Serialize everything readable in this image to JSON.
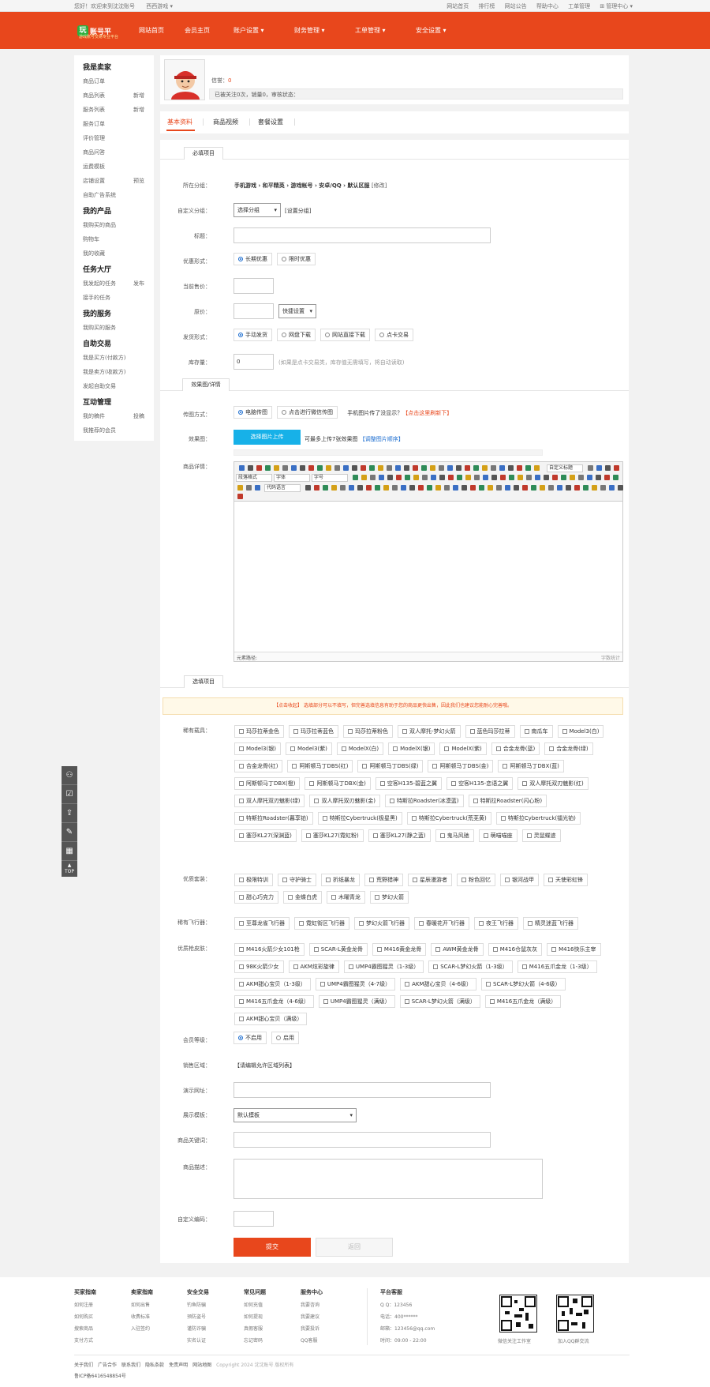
{
  "topbar": {
    "welcome": "您好！欢迎来到沈沈账号",
    "site_select": "西西游戏 ▾",
    "links": [
      "网站首页",
      "排行榜",
      "网站公告",
      "帮助中心",
      "工单管理",
      "管理中心 ▾"
    ]
  },
  "brand": {
    "logo_mark": "玩",
    "logo_name": "账号平",
    "tagline": "游戏账号交易专业平台",
    "color": "#e8471c"
  },
  "nav": [
    "网站首页",
    "会员主页",
    "账户设置 ▾",
    "财务管理 ▾",
    "工单管理 ▾",
    "安全设置 ▾"
  ],
  "sidebar": {
    "seller_title": "我是卖家",
    "seller_items": [
      "商品订单",
      "商品列表",
      "服务列表",
      "服务订单",
      "评价管理",
      "商品问答",
      "运费模板",
      "店铺设置",
      "自助广告系统"
    ],
    "seller_extras": {
      "s1": "新增",
      "s2": "新增",
      "s7": "预览"
    },
    "products_title": "我的产品",
    "products_items": [
      "我购买的商品",
      "购物车",
      "我的收藏"
    ],
    "task_title": "任务大厅",
    "task_items": [
      "我发起的任务",
      "接手的任务"
    ],
    "task_extra": "发布",
    "service_title": "我的服务",
    "service_items": [
      "我购买的服务"
    ],
    "trade_title": "自助交易",
    "trade_items": [
      "我是买方(付款方)",
      "我是卖方(收款方)",
      "发起自助交易"
    ],
    "interact_title": "互动管理",
    "interact_items": [
      "我的稿件",
      "我推荐的会员"
    ],
    "interact_extra": "投稿"
  },
  "profile": {
    "credit_label": "信誉：",
    "credit_value": "0",
    "stats": "已被关注0次，销量0，审核状态："
  },
  "tabs": [
    "基本资料",
    "商品视频",
    "套餐设置"
  ],
  "form": {
    "required_title": "必填项目",
    "category_label": "所在分组：",
    "category_value": "手机游戏 › 和平精英 › 游戏帐号 › 安卓/QQ › 默认区服",
    "category_edit": "[修改]",
    "custom_group_label": "自定义分组：",
    "custom_group_select": "选择分组",
    "custom_group_link": "[设置分组]",
    "title_label": "标题：",
    "discount_label": "优惠形式：",
    "discount_options": [
      "长期优惠",
      "限时优惠"
    ],
    "price_label": "当前售价：",
    "orig_price_label": "原价：",
    "quick_setting": "快捷设置",
    "ship_label": "发货形式：",
    "ship_options": [
      "手动发货",
      "网盘下载",
      "网站直接下载",
      "点卡交易"
    ],
    "stock_label": "库存量：",
    "stock_value": "0",
    "stock_hint": "(如果是点卡交易类，库存值无需填写，将自动读取)",
    "effect_title": "效果图/详情",
    "upload_method_label": "传图方式：",
    "upload_options": [
      "电脑传图",
      "点击进行微信传图"
    ],
    "upload_hint": "手机图片传了没显示？",
    "upload_refresh": "【点击这里刷新下】",
    "effect_label": "效果图：",
    "upload_button": "选择图片上传",
    "upload_limit": "可最多上传7张效果图",
    "adjust_order": "【调整图片顺序】",
    "detail_label": "商品详情：",
    "editor_path": "元素路径:",
    "editor_count": "字数统计",
    "editor_selects": [
      "段落格式",
      "字体",
      "字号",
      "代码语言",
      "自定义标题"
    ],
    "optional_title": "选填项目",
    "notice": "【点击收起】 选填部分可以不填写，但完善选填信息有助于您的商品更快出售，因此我们也建议您能耐心完善哦。",
    "vehicles_label": "稀有载具：",
    "vehicles": [
      "玛莎拉蒂金色",
      "玛莎拉蒂蓝色",
      "玛莎拉蒂粉色",
      "双人摩托-梦幻火箭",
      "蓝色玛莎拉蒂",
      "南瓜车",
      "Model3(白)",
      "Model3(银)",
      "Model3(紫)",
      "ModelX(白)",
      "ModelX(银)",
      "ModelX(紫)",
      "合金龙骨(蓝)",
      "合金龙骨(绿)",
      "合金龙骨(红)",
      "阿斯顿马丁DBS(红)",
      "阿斯顿马丁DBS(绿)",
      "阿斯顿马丁DBS(金)",
      "阿斯顿马丁DBX(蓝)",
      "阿斯顿马丁DBX(橙)",
      "阿斯顿马丁DBX(金)",
      "空客H135-碧蓝之翼",
      "空客H135-恋语之翼",
      "双人摩托双刃魅影(红)",
      "双人摩托双刃魅影(绿)",
      "双人摩托双刃魅影(金)",
      "特斯拉Roadster(冰漠蓝)",
      "特斯拉Roadster(闪心粉)",
      "特斯拉Roadster(暮享铂)",
      "特斯拉Cybertruck(极星黑)",
      "特斯拉Cybertruck(荒芜黄)",
      "特斯拉Cybertruck(镭光铂)",
      "塞莎KL27(深渊蓝)",
      "塞莎KL27(霓虹粉)",
      "塞莎KL27(静之蓝)",
      "鬼马风驰",
      "萌喵喵座",
      "灵鼠蝶迹"
    ],
    "suits_label": "优质套装：",
    "suits": [
      "极限特训",
      "守护骑士",
      "折纸暴龙",
      "荒野猎神",
      "星辰漫游者",
      "粉色回忆",
      "银河战甲",
      "天使彩虹锋",
      "甜心巧克力",
      "金蝶白虎",
      "木曜青龙",
      "梦幻火箭"
    ],
    "gliders_label": "稀有飞行器：",
    "gliders": [
      "至尊龙雀飞行器",
      "霓虹街区飞行器",
      "梦幻火箭飞行器",
      "春暖花开飞行器",
      "夜王飞行器",
      "精灵迷蓝飞行器"
    ],
    "skins_label": "优质枪皮肤：",
    "skins": [
      "M416火箭少女101枪",
      "SCAR-L黄金龙骨",
      "M416黄金龙骨",
      "AWM黄金龙骨",
      "M416仓鼠灰灰",
      "M416快乐主宰",
      "98K火箭少女",
      "AKM炫彩旋律",
      "UMP4霸图猩灵（1-3级）",
      "SCAR-L梦幻火箭（1-3级）",
      "M416五爪金龙（1-3级）",
      "AKM甜心宝贝（1-3级）",
      "UMP4霸图猩灵（4-7级）",
      "AKM甜心宝贝（4-6级）",
      "SCAR-L梦幻火箭（4-6级）",
      "M416五爪金龙（4-6级）",
      "UMP4霸图猩灵（满级）",
      "SCAR-L梦幻火箭（满级）",
      "M416五爪金龙（满级）",
      "AKM甜心宝贝（满级）"
    ],
    "member_label": "会员等级：",
    "member_options": [
      "不启用",
      "启用"
    ],
    "region_label": "销售区域：",
    "region_value": "【请编辑允许区域列表】",
    "demo_label": "演示网址：",
    "template_label": "展示模板：",
    "template_value": "默认模板",
    "keywords_label": "商品关键词：",
    "desc_label": "商品描述：",
    "code_label": "自定义编码：",
    "submit": "提交",
    "back": "返回"
  },
  "sidetool": {
    "top": "TOP"
  },
  "footer": {
    "cols": [
      {
        "title": "买家指南",
        "items": [
          "如何注册",
          "如何购买",
          "搜索商品",
          "支付方式"
        ]
      },
      {
        "title": "卖家指南",
        "items": [
          "如何出售",
          "收费标准",
          "入驻签约"
        ]
      },
      {
        "title": "安全交易",
        "items": [
          "钓鱼防骗",
          "预防盗号",
          "谨防诈骗",
          "实名认证"
        ]
      },
      {
        "title": "常见问题",
        "items": [
          "如何充值",
          "如何提现",
          "真假客服",
          "忘记密码"
        ]
      },
      {
        "title": "服务中心",
        "items": [
          "我要咨询",
          "我要建议",
          "我要投诉",
          "QQ客服"
        ]
      }
    ],
    "service_title": "平台客服",
    "qq": "Q Q：123456",
    "phone": "电话：400******",
    "email": "邮箱：123456@qq.com",
    "hours": "时间：09:00 - 22:00",
    "qr1": "微信关注工作室",
    "qr2": "加入QQ群交流",
    "links": [
      "关于我们",
      "广告合作",
      "联系我们",
      "隐私条款",
      "免责声明",
      "网站地图"
    ],
    "copyright": "Copyright 2024 沈沈账号 版权所有",
    "icp": "鲁ICP备6416548854号"
  }
}
